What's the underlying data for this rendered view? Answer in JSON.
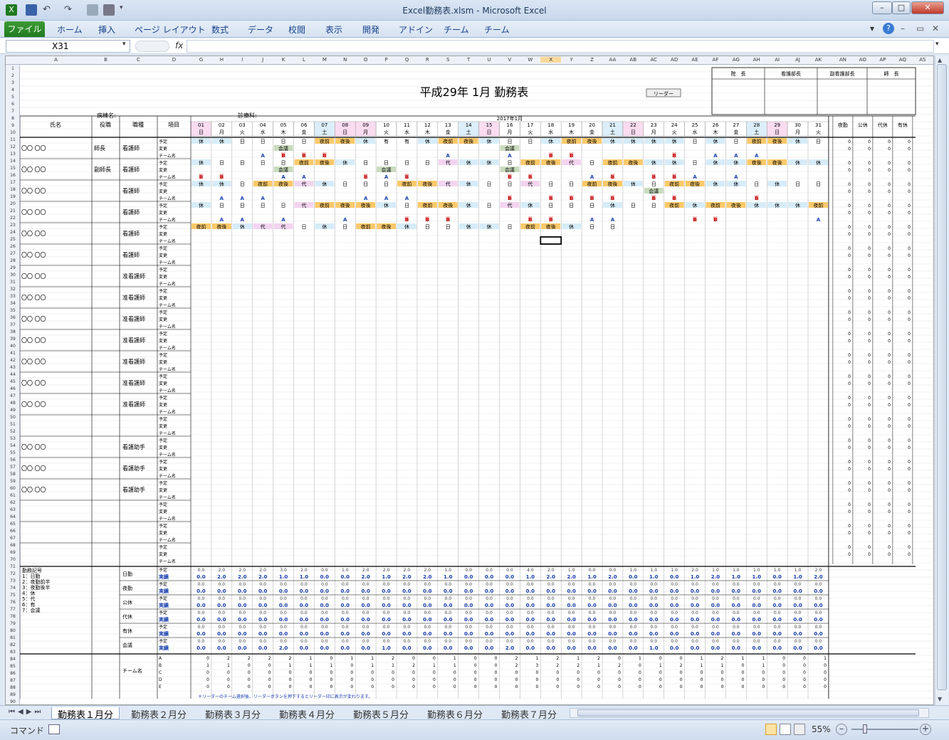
{
  "window": {
    "title": "Excel勤務表.xlsm - Microsoft Excel",
    "min": "–",
    "max": "□",
    "close": "✕"
  },
  "ribbon": {
    "file": "ファイル",
    "tabs": [
      "ホーム",
      "挿入",
      "ページ レイアウト",
      "数式",
      "データ",
      "校閲",
      "表示",
      "開発",
      "アドイン",
      "チーム",
      "チーム"
    ]
  },
  "formula_bar": {
    "name_box": "X31",
    "fx": "fx",
    "value": ""
  },
  "sheet": {
    "title": "平成29年 1月 勤務表",
    "ward_label": "病棟名:",
    "dept_label": "診療科:",
    "leader_button": "リーダー",
    "approvals": [
      "院　長",
      "看護部長",
      "副看護部長",
      "師　長"
    ],
    "month_label": "2017年1月",
    "header": {
      "name": "氏名",
      "role": "役職",
      "job": "職種",
      "item": "項目"
    },
    "totals_header": [
      "夜勤",
      "公休",
      "代休",
      "有休"
    ],
    "days": [
      "01",
      "02",
      "03",
      "04",
      "05",
      "06",
      "07",
      "08",
      "09",
      "10",
      "11",
      "12",
      "13",
      "14",
      "15",
      "16",
      "17",
      "18",
      "19",
      "20",
      "21",
      "22",
      "23",
      "24",
      "25",
      "26",
      "27",
      "28",
      "29",
      "30",
      "31"
    ],
    "weekdays": [
      "日",
      "月",
      "火",
      "水",
      "木",
      "金",
      "土",
      "日",
      "月",
      "火",
      "水",
      "木",
      "金",
      "土",
      "日",
      "月",
      "火",
      "水",
      "木",
      "金",
      "土",
      "日",
      "月",
      "火",
      "水",
      "木",
      "金",
      "土",
      "日",
      "月",
      "火"
    ],
    "item_labels": [
      "予定",
      "変更",
      "チーム名"
    ],
    "staff": [
      {
        "name": "〇〇 〇〇",
        "role": "師長",
        "job": "看護師",
        "plan": [
          "休",
          "休",
          "日",
          "日",
          "日",
          "日",
          "夜前",
          "夜後",
          "休",
          "有",
          "有",
          "休",
          "夜前",
          "夜後",
          "休",
          "日",
          "日",
          "休",
          "夜前",
          "夜後",
          "休",
          "休",
          "休",
          "休",
          "日",
          "休",
          "日",
          "夜前",
          "夜後",
          "休",
          "日"
        ],
        "change": {
          "5": "会議",
          "16": "会議"
        },
        "team": {
          "4": "A",
          "5": "B",
          "6": "B",
          "7": "B",
          "13": "A",
          "16": "A",
          "18": "B",
          "19": "B",
          "24": "B",
          "26": "A",
          "27": "A",
          "28": "A"
        }
      },
      {
        "name": "〇〇 〇〇",
        "role": "副師長",
        "job": "看護師",
        "plan": [
          "休",
          "日",
          "日",
          "日",
          "日",
          "夜前",
          "夜後",
          "休",
          "日",
          "日",
          "日",
          "日",
          "代",
          "休",
          "休",
          "日",
          "夜前",
          "夜後",
          "代",
          "日",
          "夜前",
          "夜後",
          "休",
          "休",
          "日",
          "休",
          "休",
          "夜後",
          "夜後",
          "休",
          "休"
        ],
        "change": {
          "5": "会議",
          "10": "会議",
          "16": "会議"
        },
        "team": {
          "1": "B",
          "2": "B",
          "5": "A",
          "6": "A",
          "9": "B",
          "10": "A",
          "11": "B",
          "16": "B",
          "17": "B",
          "20": "A",
          "21": "B",
          "23": "B",
          "24": "B",
          "25": "A",
          "27": "A"
        }
      },
      {
        "name": "〇〇 〇〇",
        "role": "",
        "job": "看護師",
        "plan": [
          "休",
          "休",
          "日",
          "夜前",
          "夜後",
          "代",
          "休",
          "日",
          "日",
          "日",
          "夜前",
          "夜後",
          "代",
          "休",
          "日",
          "日",
          "代",
          "日",
          "日",
          "夜前",
          "夜後",
          "休",
          "日",
          "夜前",
          "夜後",
          "休",
          "休",
          "日",
          "休",
          "日",
          "日"
        ],
        "change": {
          "23": "会議"
        },
        "team": {
          "2": "A",
          "3": "A",
          "4": "A",
          "9": "A",
          "10": "A",
          "11": "A",
          "16": "B",
          "18": "B",
          "19": "B",
          "20": "B",
          "21": "B",
          "23": "B",
          "24": "B",
          "28": "B"
        }
      },
      {
        "name": "〇〇 〇〇",
        "role": "",
        "job": "看護師",
        "plan": [
          "休",
          "日",
          "日",
          "日",
          "日",
          "代",
          "夜前",
          "夜後",
          "夜後",
          "休",
          "日",
          "夜前",
          "夜後",
          "休",
          "日",
          "代",
          "休",
          "日",
          "日",
          "日",
          "休",
          "日",
          "日",
          "夜前",
          "休",
          "夜前",
          "夜後",
          "休",
          "休",
          "休",
          "夜前"
        ],
        "change": {},
        "team": {
          "2": "A",
          "3": "A",
          "5": "A",
          "8": "A",
          "11": "B",
          "12": "B",
          "13": "B",
          "17": "B",
          "18": "B",
          "20": "A",
          "21": "A",
          "25": "B",
          "26": "B",
          "31": "A"
        }
      },
      {
        "name": "〇〇 〇〇",
        "role": "",
        "job": "看護師",
        "plan": [
          "夜前",
          "夜後",
          "休",
          "代",
          "代",
          "日",
          "休",
          "日",
          "夜前",
          "夜後",
          "休",
          "日",
          "日",
          "休",
          "休",
          "日",
          "夜前",
          "夜後",
          "休",
          "日",
          "日"
        ],
        "change": {},
        "team": {}
      },
      {
        "name": "〇〇 〇〇",
        "role": "",
        "job": "看護師"
      },
      {
        "name": "〇〇 〇〇",
        "role": "",
        "job": "准看護師"
      },
      {
        "name": "〇〇 〇〇",
        "role": "",
        "job": "准看護師"
      },
      {
        "name": "〇〇 〇〇",
        "role": "",
        "job": "准看護師"
      },
      {
        "name": "〇〇 〇〇",
        "role": "",
        "job": "准看護師"
      },
      {
        "name": "〇〇 〇〇",
        "role": "",
        "job": "准看護師"
      },
      {
        "name": "〇〇 〇〇",
        "role": "",
        "job": "准看護師"
      },
      {
        "name": "〇〇 〇〇",
        "role": "",
        "job": "准看護師"
      },
      {
        "name": "",
        "role": "",
        "job": ""
      },
      {
        "name": "〇〇 〇〇",
        "role": "",
        "job": "看護助手"
      },
      {
        "name": "〇〇 〇〇",
        "role": "",
        "job": "看護助手"
      },
      {
        "name": "〇〇 〇〇",
        "role": "",
        "job": "看護助手"
      },
      {
        "name": "",
        "role": "",
        "job": ""
      },
      {
        "name": "",
        "role": "",
        "job": ""
      },
      {
        "name": "",
        "role": "",
        "job": ""
      }
    ],
    "legend": [
      "勤務記号",
      "1：日勤",
      "2：夜勤前半",
      "3：夜勤後半",
      "4：休",
      "5：代",
      "6：有",
      "7：会議"
    ],
    "summary_rows": [
      "日勤",
      "夜勤",
      "公休",
      "代休",
      "有休",
      "会議"
    ],
    "summary_sub": [
      "予定",
      "実績"
    ],
    "nikkin_plan": [
      "0.0",
      "2.0",
      "2.0",
      "2.0",
      "3.0",
      "2.0",
      "0.0",
      "1.0",
      "2.0",
      "2.0",
      "2.0",
      "2.0",
      "1.0",
      "0.0",
      "0.0",
      "0.0",
      "4.0",
      "2.0",
      "1.0",
      "0.0",
      "0.0",
      "1.0",
      "1.0",
      "1.0",
      "2.0",
      "1.0",
      "1.0",
      "1.0",
      "1.0",
      "1.0",
      "2.0"
    ],
    "nikkin_actual": [
      "0.0",
      "2.0",
      "2.0",
      "2.0",
      "1.0",
      "1.0",
      "0.0",
      "0.0",
      "2.0",
      "1.0",
      "2.0",
      "2.0",
      "1.0",
      "0.0",
      "0.0",
      "0.0",
      "1.0",
      "2.0",
      "2.0",
      "1.0",
      "2.0",
      "0.0",
      "1.0",
      "0.0",
      "1.0",
      "2.0",
      "1.0",
      "1.0",
      "0.0",
      "1.0",
      "2.0"
    ],
    "kaigi_actual": [
      "0.0",
      "0.0",
      "0.0",
      "0.0",
      "2.0",
      "0.0",
      "0.0",
      "0.0",
      "0.0",
      "1.0",
      "0.0",
      "0.0",
      "0.0",
      "0.0",
      "0.0",
      "2.0",
      "0.0",
      "0.0",
      "0.0",
      "0.0",
      "0.0",
      "0.0",
      "1.0",
      "0.0",
      "0.0",
      "0.0",
      "0.0",
      "0.0",
      "0.0",
      "0.0",
      "0.0"
    ],
    "zero": "0.0",
    "team_label": "チーム名",
    "teams": [
      "A",
      "B",
      "C",
      "D",
      "E"
    ],
    "team_A": [
      "0",
      "2",
      "2",
      "2",
      "2",
      "1",
      "0",
      "1",
      "1",
      "2",
      "0",
      "0",
      "1",
      "0",
      "0",
      "2",
      "1",
      "2",
      "1",
      "2",
      "0",
      "1",
      "0",
      "0",
      "1",
      "2",
      "1",
      "1",
      "0",
      "0",
      "1"
    ],
    "team_B": [
      "1",
      "1",
      "0",
      "0",
      "1",
      "1",
      "1",
      "0",
      "1",
      "1",
      "2",
      "1",
      "1",
      "0",
      "0",
      "2",
      "3",
      "2",
      "2",
      "1",
      "2",
      "0",
      "1",
      "2",
      "1",
      "1",
      "0",
      "1",
      "0",
      "0",
      "0"
    ],
    "note": "＊リーダーのチーム選択後、リーダーボタンを押下するとリーダー印に表示が変わります。"
  },
  "sheet_tabs": [
    "勤務表１月分",
    "勤務表２月分",
    "勤務表３月分",
    "勤務表４月分",
    "勤務表５月分",
    "勤務表６月分",
    "勤務表７月分"
  ],
  "status": {
    "mode": "コマンド",
    "zoom": "55%"
  }
}
